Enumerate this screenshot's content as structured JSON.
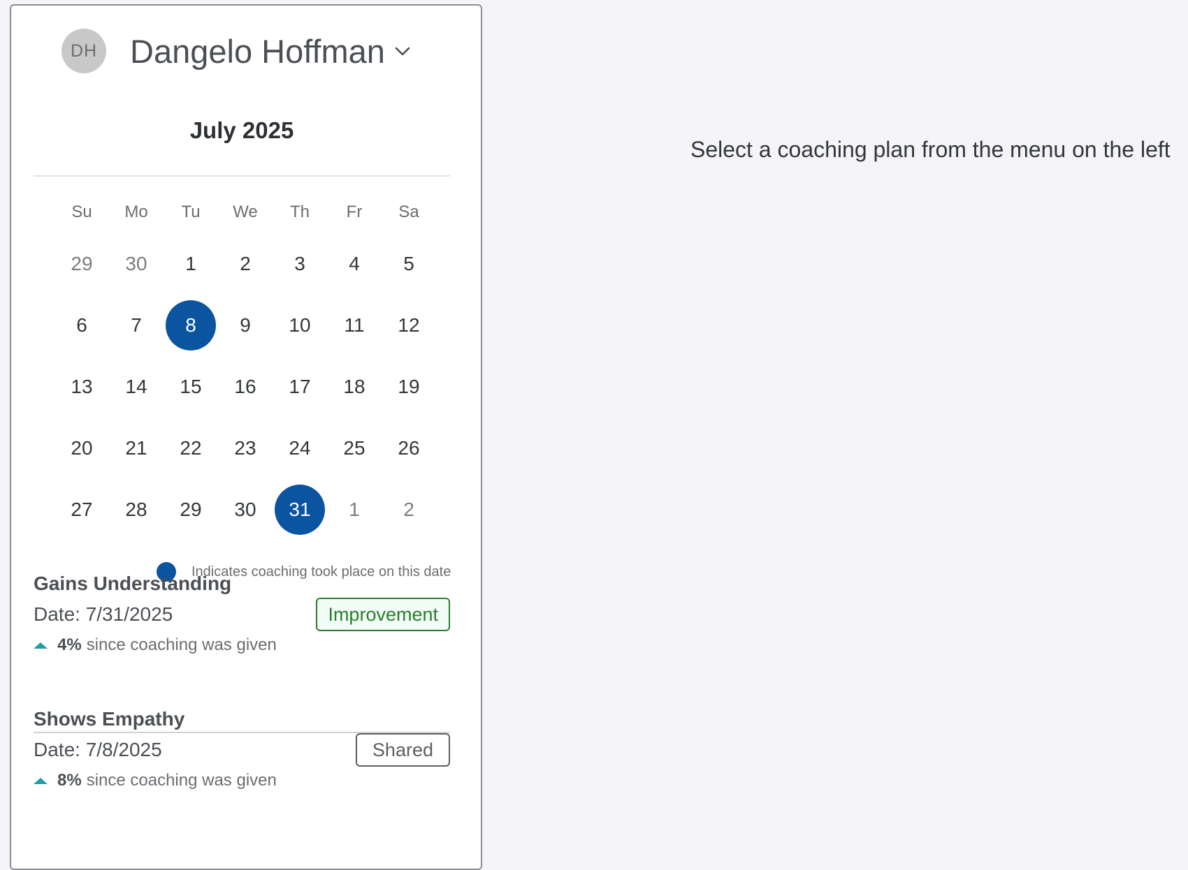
{
  "user": {
    "initials": "DH",
    "name": "Dangelo Hoffman"
  },
  "calendar": {
    "month_label": "July 2025",
    "weekdays": [
      "Su",
      "Mo",
      "Tu",
      "We",
      "Th",
      "Fr",
      "Sa"
    ],
    "weeks": [
      [
        {
          "d": "29",
          "m": true
        },
        {
          "d": "30",
          "m": true
        },
        {
          "d": "1"
        },
        {
          "d": "2"
        },
        {
          "d": "3"
        },
        {
          "d": "4"
        },
        {
          "d": "5"
        }
      ],
      [
        {
          "d": "6"
        },
        {
          "d": "7"
        },
        {
          "d": "8",
          "c": true
        },
        {
          "d": "9"
        },
        {
          "d": "10"
        },
        {
          "d": "11"
        },
        {
          "d": "12"
        }
      ],
      [
        {
          "d": "13"
        },
        {
          "d": "14"
        },
        {
          "d": "15"
        },
        {
          "d": "16"
        },
        {
          "d": "17"
        },
        {
          "d": "18"
        },
        {
          "d": "19"
        }
      ],
      [
        {
          "d": "20"
        },
        {
          "d": "21"
        },
        {
          "d": "22"
        },
        {
          "d": "23"
        },
        {
          "d": "24"
        },
        {
          "d": "25"
        },
        {
          "d": "26"
        }
      ],
      [
        {
          "d": "27"
        },
        {
          "d": "28"
        },
        {
          "d": "29"
        },
        {
          "d": "30"
        },
        {
          "d": "31",
          "c": true
        },
        {
          "d": "1",
          "m": true
        },
        {
          "d": "2",
          "m": true
        }
      ]
    ],
    "legend_text": "Indicates coaching took place on this date",
    "coached_color": "#0a54a0"
  },
  "plans": [
    {
      "title": "Gains Understanding",
      "date": "Date: 7/31/2025",
      "change_value": "4%",
      "change_text": "since coaching was given",
      "status": "Improvement"
    },
    {
      "title": "Shows Empathy",
      "date": "Date: 7/8/2025",
      "change_value": "8%",
      "change_text": "since coaching was given",
      "status": "Shared"
    }
  ],
  "main": {
    "empty_message": "Select a coaching plan from the menu on the left"
  }
}
